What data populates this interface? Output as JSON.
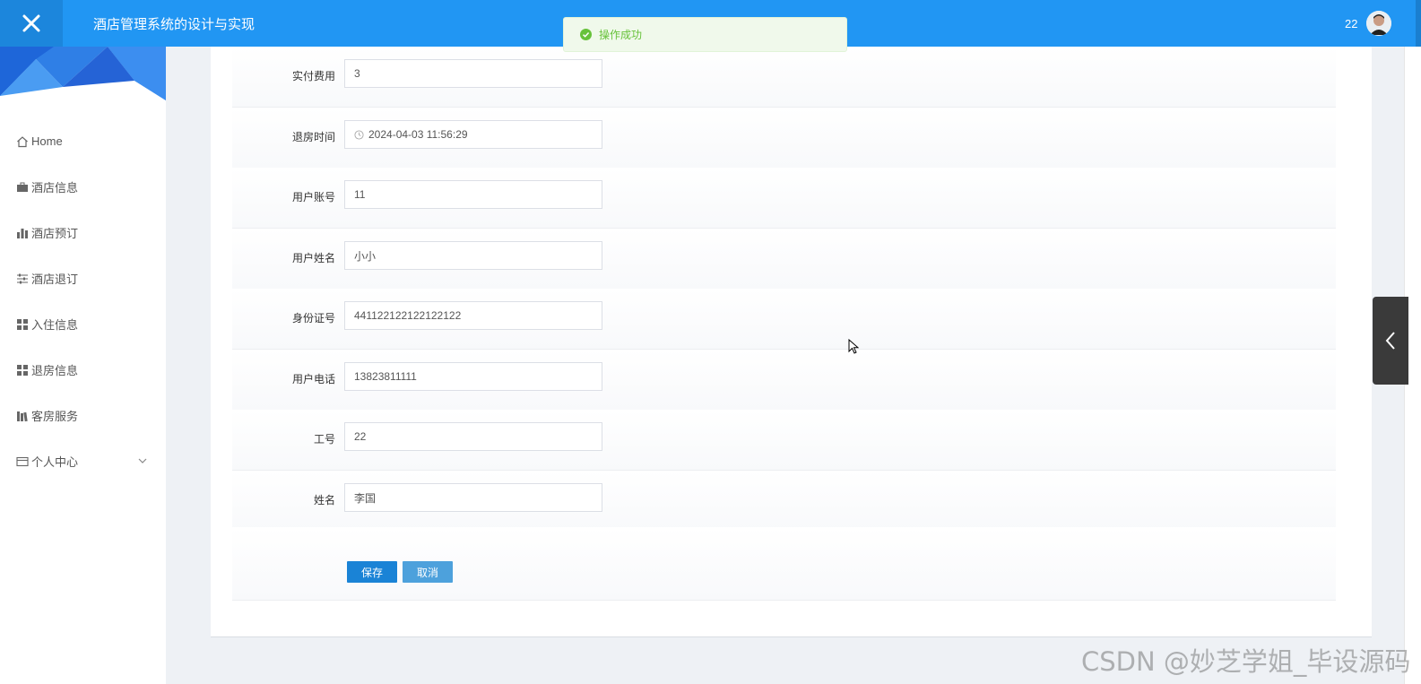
{
  "header": {
    "title": "酒店管理系统的设计与实现",
    "user": "22",
    "colors": {
      "bar": "#2196f3",
      "close_bg": "#1c86dc"
    }
  },
  "toast": {
    "text": "操作成功",
    "type": "success"
  },
  "sidebar": {
    "items": [
      {
        "label": "Home",
        "icon": "home-icon"
      },
      {
        "label": "酒店信息",
        "icon": "briefcase-icon"
      },
      {
        "label": "酒店预订",
        "icon": "bar-chart-icon"
      },
      {
        "label": "酒店退订",
        "icon": "sliders-icon"
      },
      {
        "label": "入住信息",
        "icon": "grid-icon"
      },
      {
        "label": "退房信息",
        "icon": "grid-icon"
      },
      {
        "label": "客房服务",
        "icon": "books-icon"
      },
      {
        "label": "个人中心",
        "icon": "card-icon",
        "expandable": true
      }
    ]
  },
  "form": {
    "fields": [
      {
        "label": "实付费用",
        "value": "3"
      },
      {
        "label": "退房时间",
        "value": "2024-04-03 11:56:29",
        "icon": "clock-icon"
      },
      {
        "label": "用户账号",
        "value": "11"
      },
      {
        "label": "用户姓名",
        "value": "小小"
      },
      {
        "label": "身份证号",
        "value": "441122122122122122"
      },
      {
        "label": "用户电话",
        "value": "13823811111"
      },
      {
        "label": "工号",
        "value": "22"
      },
      {
        "label": "姓名",
        "value": "李国"
      }
    ],
    "save_label": "保存",
    "cancel_label": "取消"
  },
  "watermark": "CSDN @妙芝学姐_毕设源码"
}
